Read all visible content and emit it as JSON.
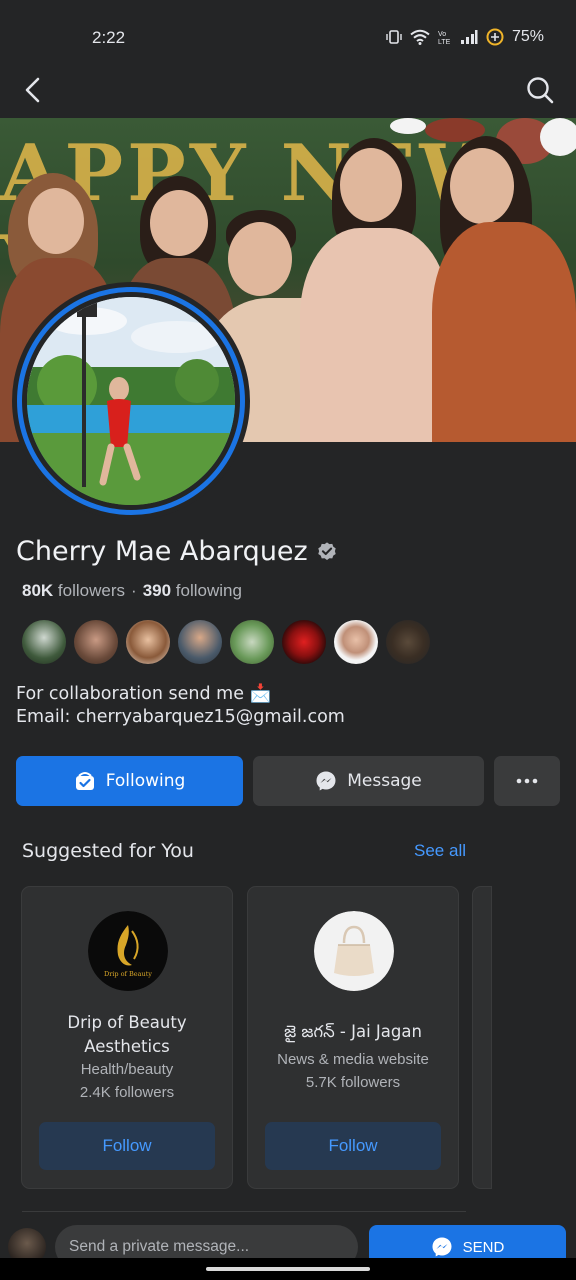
{
  "status_bar": {
    "time": "2:22",
    "battery_percent": "75%"
  },
  "nav": {
    "back_icon": "back-arrow-icon",
    "search_icon": "search-icon"
  },
  "profile": {
    "name": "Cherry Mae Abarquez",
    "verified": true,
    "followers_count": "80K",
    "followers_label": "followers",
    "separator": "·",
    "following_count": "390",
    "following_label": "following",
    "bio_line1": "For collaboration send me 📩",
    "bio_line2": "Email: cherryabarquez15@gmail.com"
  },
  "actions": {
    "following_label": "Following",
    "message_label": "Message",
    "more_icon": "more-dots-icon"
  },
  "suggested": {
    "title": "Suggested for You",
    "see_all": "See all",
    "cards": [
      {
        "name": "Drip of Beauty Aesthetics",
        "category": "Health/beauty",
        "followers": "2.4K followers",
        "button": "Follow",
        "logo_text": "Drip of Beauty"
      },
      {
        "name": "జై జగన్ - Jai Jagan",
        "category": "News & media website",
        "followers": "5.7K followers",
        "button": "Follow"
      }
    ]
  },
  "composer": {
    "placeholder": "Send a private message...",
    "send_label": "SEND"
  },
  "colors": {
    "accent": "#1b74e4",
    "link": "#4599ff",
    "background": "#242526",
    "surface": "#3a3b3c"
  }
}
